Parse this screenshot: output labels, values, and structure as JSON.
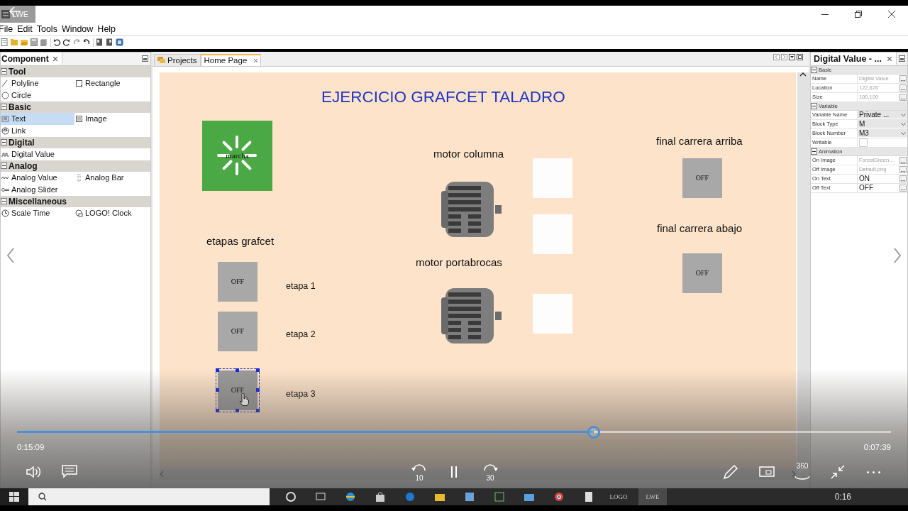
{
  "title_bar": {
    "app_label": "LWE"
  },
  "menu": [
    "File",
    "Edit",
    "Tools",
    "Window",
    "Help"
  ],
  "component_panel": {
    "title": "Component",
    "sections": [
      {
        "title": "Tool",
        "expanded": true,
        "items": [
          {
            "label": "Polyline",
            "selected": false
          },
          {
            "label": "Rectangle",
            "selected": false
          },
          {
            "label": "Circle",
            "selected": false
          }
        ]
      },
      {
        "title": "Basic",
        "expanded": true,
        "items": [
          {
            "label": "Text",
            "selected": true
          },
          {
            "label": "Image",
            "selected": false
          },
          {
            "label": "Link",
            "selected": false
          }
        ]
      },
      {
        "title": "Digital",
        "expanded": true,
        "items": [
          {
            "label": "Digital Value",
            "selected": false
          }
        ]
      },
      {
        "title": "Analog",
        "expanded": true,
        "items": [
          {
            "label": "Analog Value",
            "selected": false
          },
          {
            "label": "Analog Bar",
            "selected": false
          },
          {
            "label": "Analog Slider",
            "selected": false
          }
        ]
      },
      {
        "title": "Miscellaneous",
        "expanded": true,
        "items": [
          {
            "label": "Scale Time",
            "selected": false
          },
          {
            "label": "LOGO! Clock",
            "selected": false
          }
        ]
      }
    ]
  },
  "editor_tabs": [
    {
      "label": "Projects",
      "selected": false
    },
    {
      "label": "Home Page",
      "selected": true
    }
  ],
  "canvas": {
    "elements": [
      {
        "kind": "heading",
        "text": "EJERCICIO GRAFCET TALADRO"
      },
      {
        "kind": "button",
        "text": "marcha"
      },
      {
        "kind": "text",
        "text": "etapas grafcet"
      },
      {
        "kind": "indicator",
        "text": "OFF",
        "selected": false
      },
      {
        "kind": "small",
        "text": "etapa 1"
      },
      {
        "kind": "indicator",
        "text": "OFF",
        "selected": false
      },
      {
        "kind": "small",
        "text": "etapa 2"
      },
      {
        "kind": "indicator",
        "text": "OFF",
        "selected": true
      },
      {
        "kind": "small",
        "text": "etapa 3"
      },
      {
        "kind": "text",
        "text": "motor columna"
      },
      {
        "kind": "motor"
      },
      {
        "kind": "text",
        "text": "motor portabrocas"
      },
      {
        "kind": "motor"
      },
      {
        "kind": "lamp"
      },
      {
        "kind": "lamp"
      },
      {
        "kind": "lamp"
      },
      {
        "kind": "text",
        "text": "final carrera arriba"
      },
      {
        "kind": "indicator",
        "text": "OFF",
        "selected": false
      },
      {
        "kind": "text",
        "text": "final carrera abajo"
      },
      {
        "kind": "indicator",
        "text": "OFF",
        "selected": false
      }
    ]
  },
  "properties_panel": {
    "title": "Digital Value - ...",
    "sections": [
      {
        "title": "Basic",
        "expanded": true,
        "rows": [
          {
            "name": "Name",
            "kind": "text",
            "value": "Digital Value",
            "dimmed": true
          },
          {
            "name": "Location",
            "kind": "text",
            "value": "122,626",
            "dimmed": true
          },
          {
            "name": "Size",
            "kind": "text",
            "value": "100,100",
            "dimmed": true
          }
        ]
      },
      {
        "title": "Variable",
        "expanded": true,
        "rows": [
          {
            "name": "Variable Name",
            "kind": "dropdown",
            "value": "Private ...",
            "dimmed": false
          },
          {
            "name": "Block Type",
            "kind": "dropdown",
            "value": "M",
            "dimmed": false
          },
          {
            "name": "Block Number",
            "kind": "dropdown",
            "value": "M3",
            "dimmed": false
          },
          {
            "name": "Writable",
            "kind": "checkbox",
            "checked": false
          }
        ]
      },
      {
        "title": "Animation",
        "expanded": true,
        "rows": [
          {
            "name": "On Image",
            "kind": "text",
            "value": "ForestGreen....",
            "dimmed": true
          },
          {
            "name": "Off Image",
            "kind": "text",
            "value": "Default.png",
            "dimmed": true
          },
          {
            "name": "On Text",
            "kind": "text",
            "value": "ON",
            "dimmed": false
          },
          {
            "name": "Off Text",
            "kind": "text",
            "value": "OFF",
            "dimmed": false
          }
        ]
      }
    ]
  },
  "player": {
    "elapsed": "0:15:09",
    "remaining": "0:07:39",
    "position": {
      "level": 0.66
    },
    "skip_back_label": "10",
    "skip_forward_label": "30",
    "view_label": "360"
  },
  "taskbar": {
    "apps": [
      "LOGO",
      "LWE"
    ],
    "clock": "0:16"
  }
}
